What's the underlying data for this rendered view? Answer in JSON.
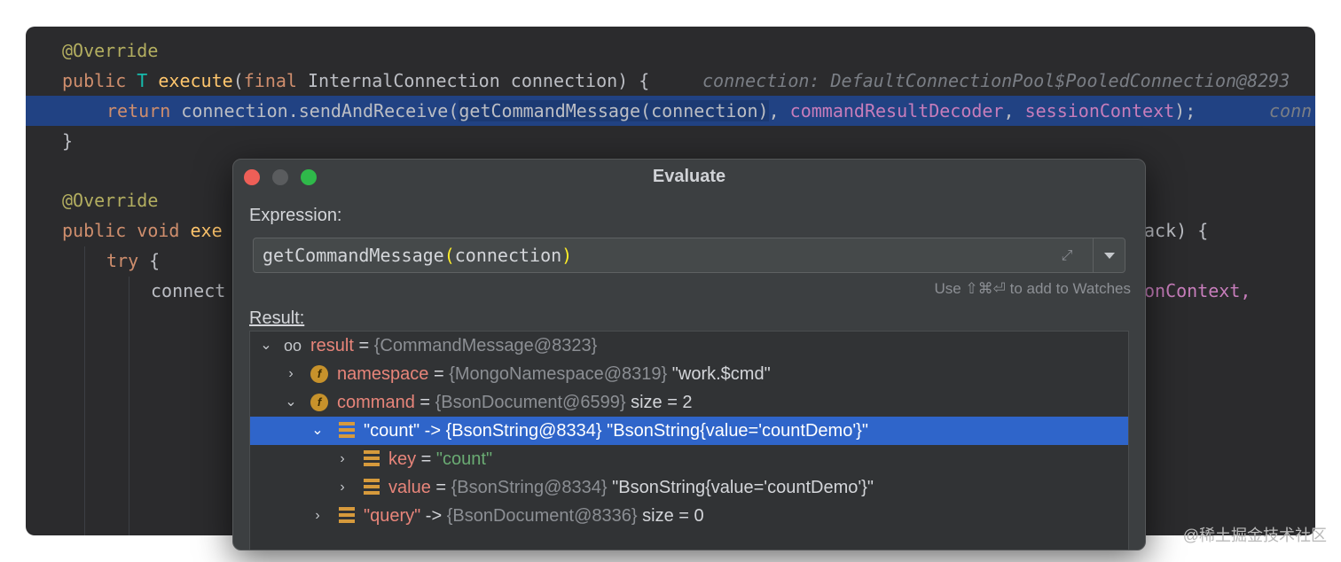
{
  "editor": {
    "lines": [
      {
        "ann": "@Override"
      },
      {
        "kw": "public",
        "tparam": "T",
        "method": "execute",
        "open": "(",
        "kw2": "final",
        "rest": " InternalConnection connection) {",
        "hint": "connection: DefaultConnectionPool$PooledConnection@8293"
      },
      {
        "kw": "return",
        "pre": " connection.sendAndReceive(",
        "sel": "getCommandMessage(connection)",
        "fld1": "commandResultDecoder",
        "fld2": "sessionContext",
        "post": ");",
        "hint": "conn"
      },
      {
        "text": "}"
      },
      {
        "ann": "@Override"
      },
      {
        "kw": "public void",
        "frag": "exe",
        "tail": "ack) {"
      },
      {
        "kw": "try",
        "rest": " {"
      },
      {
        "frag": "connect",
        "tail": "onContext,"
      }
    ]
  },
  "dialog": {
    "title": "Evaluate",
    "expression_label": "Expression:",
    "expression_pre": "getCommandMessage",
    "expression_open": "(",
    "expression_arg": "connection",
    "expression_close": ")",
    "watch_hint": "Use ⇧⌘⏎ to add to Watches",
    "result_label": "Result:",
    "result_rows": [
      {
        "name": "result",
        "eq": " = ",
        "ref": "{CommandMessage@8323}",
        "extra": ""
      },
      {
        "name": "namespace",
        "eq": " = ",
        "ref": "{MongoNamespace@8319}",
        "extra": " \"work.$cmd\""
      },
      {
        "name": "command",
        "eq": " = ",
        "ref": "{BsonDocument@6599}",
        "extra": "  size = 2"
      },
      {
        "name": "\"count\"",
        "eq": " -> ",
        "ref": "{BsonString@8334}",
        "extra": " \"BsonString{value='countDemo'}\""
      },
      {
        "name": "key",
        "eq": " = ",
        "str": "\"count\""
      },
      {
        "name": "value",
        "eq": " = ",
        "ref": "{BsonString@8334}",
        "extra": " \"BsonString{value='countDemo'}\""
      },
      {
        "name": "\"query\"",
        "eq": " -> ",
        "ref": "{BsonDocument@8336}",
        "extra": "  size = 0"
      }
    ]
  },
  "watermark": "@稀土掘金技术社区",
  "icons": [
    "close-button-icon",
    "minimize-button-icon",
    "maximize-button-icon",
    "expand-icon",
    "dropdown-arrow-icon",
    "chevron-down-icon",
    "chevron-right-icon",
    "glasses-icon",
    "field-icon",
    "array-icon"
  ],
  "colors": {
    "editor_bg": "#2b2b2d",
    "dialog_bg": "#3c3f41",
    "selection": "#2f65ca",
    "line_highlight": "#214283"
  }
}
